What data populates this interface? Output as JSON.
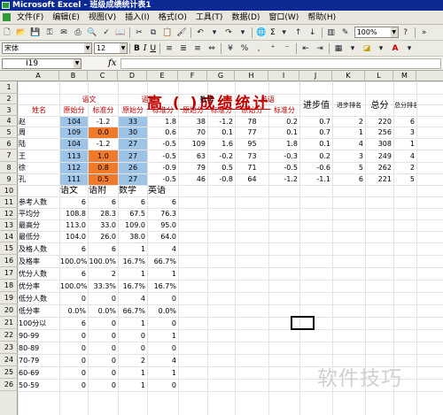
{
  "window": {
    "title": "Microsoft Excel - 班级成绩统计表1"
  },
  "menu": [
    "文件(F)",
    "编辑(E)",
    "视图(V)",
    "插入(I)",
    "格式(O)",
    "工具(T)",
    "数据(D)",
    "窗口(W)",
    "帮助(H)"
  ],
  "toolbar": {
    "sigma": "Σ",
    "zoom": "100%",
    "font": "宋体",
    "size": "12",
    "bold": "B",
    "italic": "I",
    "underline": "U"
  },
  "formula": {
    "name_box": "I19",
    "fx": "fx",
    "content": ""
  },
  "columns": [
    "A",
    "B",
    "C",
    "D",
    "E",
    "F",
    "G",
    "H",
    "I",
    "J",
    "K",
    "L",
    "M"
  ],
  "rows": [
    "1",
    "2",
    "3",
    "4",
    "5",
    "6",
    "7",
    "8",
    "9",
    "10",
    "11",
    "12",
    "13",
    "14",
    "15",
    "16",
    "17",
    "18",
    "19",
    "20",
    "21",
    "22",
    "23",
    "24",
    "25",
    "26"
  ],
  "sheet": {
    "title": "高    (    )成绩统计",
    "subjects": {
      "chinese": "语文",
      "math_sub": "语附",
      "math": "数学",
      "english": "英语"
    },
    "headers": {
      "name": "姓名",
      "raw": "原始分",
      "std": "标准分",
      "progress": "进步值",
      "progress_rank": "进步排名",
      "total": "总分",
      "total_rank": "总分排名"
    },
    "students": [
      {
        "name": "赵",
        "c": "104",
        "cs": "-1.2",
        "m": "33",
        "ms": "1.8",
        "ma": "38",
        "mas": "-1.2",
        "e": "78",
        "es": "0.2",
        "p": "0.7",
        "pr": "2",
        "t": "220",
        "tr": "6"
      },
      {
        "name": "周",
        "c": "109",
        "cs": "0.0",
        "m": "30",
        "ms": "0.6",
        "ma": "70",
        "mas": "0.1",
        "e": "77",
        "es": "0.1",
        "p": "0.7",
        "pr": "1",
        "t": "256",
        "tr": "3"
      },
      {
        "name": "陆",
        "c": "104",
        "cs": "-1.2",
        "m": "27",
        "ms": "-0.5",
        "ma": "109",
        "mas": "1.6",
        "e": "95",
        "es": "1.8",
        "p": "0.1",
        "pr": "4",
        "t": "308",
        "tr": "1"
      },
      {
        "name": "王",
        "c": "113",
        "cs": "1.0",
        "m": "27",
        "ms": "-0.5",
        "ma": "63",
        "mas": "-0.2",
        "e": "73",
        "es": "-0.3",
        "p": "0.2",
        "pr": "3",
        "t": "249",
        "tr": "4"
      },
      {
        "name": "徐",
        "c": "112",
        "cs": "0.8",
        "m": "26",
        "ms": "-0.9",
        "ma": "79",
        "mas": "0.5",
        "e": "71",
        "es": "-0.5",
        "p": "-0.6",
        "pr": "5",
        "t": "262",
        "tr": "2"
      },
      {
        "name": "孔",
        "c": "111",
        "cs": "0.5",
        "m": "27",
        "ms": "-0.5",
        "ma": "46",
        "mas": "-0.8",
        "e": "64",
        "es": "-1.2",
        "p": "-1.1",
        "pr": "6",
        "t": "221",
        "tr": "5"
      }
    ],
    "stats_headers": [
      "语文",
      "语附",
      "数学",
      "英语"
    ],
    "stats": [
      {
        "label": "参考人数",
        "v": [
          "6",
          "6",
          "6",
          "6"
        ]
      },
      {
        "label": "平均分",
        "v": [
          "108.8",
          "28.3",
          "67.5",
          "76.3"
        ]
      },
      {
        "label": "最高分",
        "v": [
          "113.0",
          "33.0",
          "109.0",
          "95.0"
        ]
      },
      {
        "label": "最低分",
        "v": [
          "104.0",
          "26.0",
          "38.0",
          "64.0"
        ]
      },
      {
        "label": "及格人数",
        "v": [
          "6",
          "6",
          "1",
          "4"
        ]
      },
      {
        "label": "及格率",
        "v": [
          "100.0%",
          "100.0%",
          "16.7%",
          "66.7%"
        ]
      },
      {
        "label": "优分人数",
        "v": [
          "6",
          "2",
          "1",
          "1"
        ]
      },
      {
        "label": "优分率",
        "v": [
          "100.0%",
          "33.3%",
          "16.7%",
          "16.7%"
        ]
      },
      {
        "label": "低分人数",
        "v": [
          "0",
          "0",
          "4",
          "0"
        ]
      },
      {
        "label": "低分率",
        "v": [
          "0.0%",
          "0.0%",
          "66.7%",
          "0.0%"
        ]
      },
      {
        "label": "100分以",
        "v": [
          "6",
          "0",
          "1",
          "0"
        ]
      },
      {
        "label": "90-99",
        "v": [
          "0",
          "0",
          "0",
          "1"
        ]
      },
      {
        "label": "80-89",
        "v": [
          "0",
          "0",
          "0",
          "0"
        ]
      },
      {
        "label": "70-79",
        "v": [
          "0",
          "0",
          "2",
          "4"
        ]
      },
      {
        "label": "60-69",
        "v": [
          "0",
          "0",
          "1",
          "1"
        ]
      },
      {
        "label": "50-59",
        "v": [
          "0",
          "0",
          "1",
          "0"
        ]
      }
    ]
  },
  "watermark": "软件技巧"
}
